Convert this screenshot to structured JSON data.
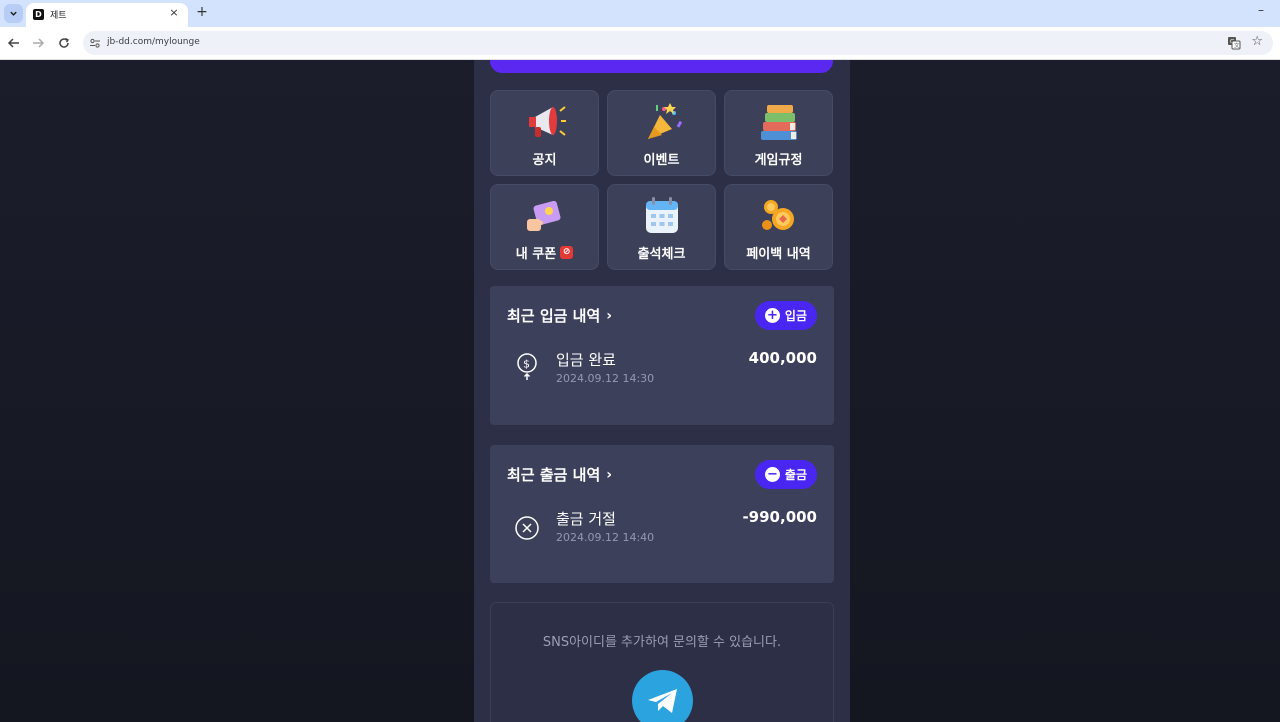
{
  "browser": {
    "tab_title": "제트",
    "tab_close": "×",
    "new_tab": "+",
    "minimize": "–",
    "url": "jb-dd.com/mylounge",
    "favicon_letter": "D"
  },
  "menu": {
    "items": [
      {
        "label": "공지",
        "icon": "megaphone-icon"
      },
      {
        "label": "이벤트",
        "icon": "party-popper-icon"
      },
      {
        "label": "게임규정",
        "icon": "books-icon"
      },
      {
        "label": "내 쿠폰",
        "icon": "coupon-icon",
        "badge": "⊘"
      },
      {
        "label": "출석체크",
        "icon": "calendar-icon"
      },
      {
        "label": "페이백 내역",
        "icon": "coins-icon"
      }
    ]
  },
  "deposit": {
    "title": "최근 입금 내역",
    "chevron": "›",
    "button_label": "입금",
    "button_icon": "+",
    "item": {
      "status": "입금 완료",
      "date": "2024.09.12 14:30",
      "amount": "400,000"
    }
  },
  "withdraw": {
    "title": "최근 출금 내역",
    "chevron": "›",
    "button_label": "출금",
    "button_icon": "−",
    "item": {
      "status": "출금 거절",
      "date": "2024.09.12 14:40",
      "amount": "-990,000"
    }
  },
  "sns": {
    "text": "SNS아이디를 추가하여 문의할 수 있습니다."
  },
  "colors": {
    "accent": "#4a26f2",
    "panel": "#2c2f45",
    "card": "#3d405b",
    "telegram": "#2aa3de"
  }
}
